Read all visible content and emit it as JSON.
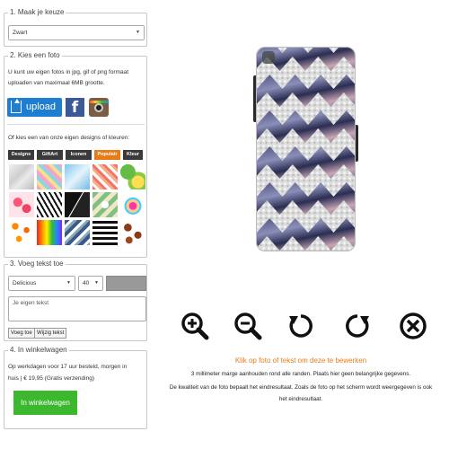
{
  "step1": {
    "legend": "1. Maak je keuze",
    "selected": "Zwart"
  },
  "step2": {
    "legend": "2. Kies een foto",
    "intro_line1": "U kunt uw eigen fotos in jpg, gif of png formaat",
    "intro_line2": "uploaden van maximaal 6MB grootte.",
    "upload_label": "upload",
    "facebook_letter": "f",
    "designs_prompt": "Of kies een van onze eigen designs of kleuren:",
    "tabs": [
      "Designs",
      "GiftArt",
      "Iconen",
      "Populair",
      "Kleur"
    ],
    "active_tab": "Populair"
  },
  "step3": {
    "legend": "3. Voeg tekst toe",
    "font": "Delicious",
    "size": "40",
    "text_placeholder": "Je eigen tekst",
    "add_label": "Voeg toe",
    "edit_label": "Wijzig tekst"
  },
  "step4": {
    "legend": "4. In winkelwagen",
    "delivery_line1": "Op werkdagen voor 17 uur besteld, morgen in",
    "delivery_line2": "huis | € 19,95 (Gratis verzending)",
    "cart_label": "In winkelwagen",
    "cart_color": "#3cb82e"
  },
  "tools": [
    "zoom-in-icon",
    "zoom-out-icon",
    "rotate-left-icon",
    "rotate-right-icon",
    "close-icon"
  ],
  "hints": {
    "edit": "Klik op foto of tekst om deze te bewerken",
    "margin": "3 millimeter marge aanhouden rond alle randen. Plaats hier geen belangrijke gegevens.",
    "quality_line1": "De kwaliteit van de foto bepaalt het eindresultaat. Zoals de foto op het scherm wordt weergegeven is ook",
    "quality_line2": "het eindresultaat."
  },
  "colors": {
    "accent": "#e97b17",
    "upload_blue": "#1e7fd2",
    "facebook": "#3b5998"
  }
}
